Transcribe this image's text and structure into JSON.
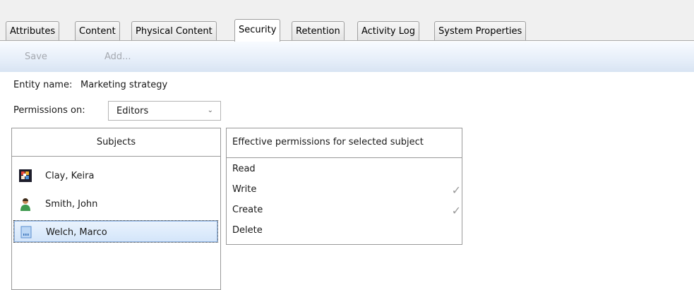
{
  "tabs": [
    {
      "label": "Attributes",
      "active": false
    },
    {
      "label": "Content",
      "active": false
    },
    {
      "label": "Physical Content",
      "active": false
    },
    {
      "label": "Security",
      "active": true
    },
    {
      "label": "Retention",
      "active": false
    },
    {
      "label": "Activity Log",
      "active": false
    },
    {
      "label": "System Properties",
      "active": false
    }
  ],
  "toolbar": {
    "save_label": "Save",
    "add_label": "Add..."
  },
  "entity": {
    "label": "Entity name:",
    "value": "Marketing strategy"
  },
  "permissions_on": {
    "label": "Permissions on:",
    "selected": "Editors"
  },
  "subjects": {
    "header": "Subjects",
    "items": [
      {
        "name": "Clay, Keira",
        "icon": "user-photo-icon",
        "selected": false
      },
      {
        "name": "Smith, John",
        "icon": "user-person-icon",
        "selected": false
      },
      {
        "name": "Welch, Marco",
        "icon": "user-document-icon",
        "selected": true
      }
    ]
  },
  "effective": {
    "header": "Effective permissions for selected subject",
    "items": [
      {
        "name": "Read",
        "checked": false
      },
      {
        "name": "Write",
        "checked": true
      },
      {
        "name": "Create",
        "checked": true
      },
      {
        "name": "Delete",
        "checked": false
      }
    ]
  },
  "colors": {
    "toolbar": "#dfe9f6",
    "selection": "#d3e5fa",
    "check": "#9a9a9a"
  }
}
